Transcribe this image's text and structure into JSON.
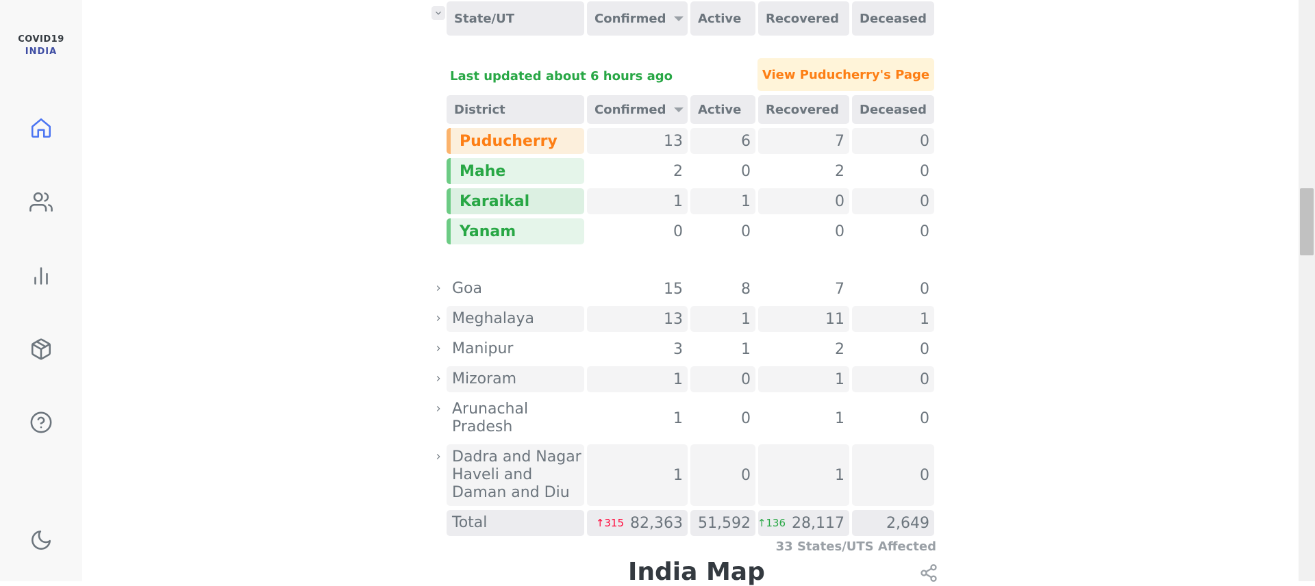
{
  "sidebar": {
    "logo_line1": "COVID19",
    "logo_line2": "INDIA",
    "items": [
      {
        "icon": "home-icon",
        "active": true
      },
      {
        "icon": "users-icon"
      },
      {
        "icon": "bar-chart-icon"
      },
      {
        "icon": "package-icon"
      },
      {
        "icon": "help-circle-icon"
      },
      {
        "icon": "moon-icon"
      }
    ]
  },
  "table": {
    "headers": {
      "state": "State/UT",
      "confirmed": "Confirmed",
      "active": "Active",
      "recovered": "Recovered",
      "deceased": "Deceased"
    },
    "expanded_state": {
      "last_updated": "Last updated about 6 hours ago",
      "view_page_button": "View Puducherry's Page",
      "district_headers": {
        "district": "District",
        "confirmed": "Confirmed",
        "active": "Active",
        "recovered": "Recovered",
        "deceased": "Deceased"
      },
      "districts": [
        {
          "name": "Puducherry",
          "confirmed": "13",
          "active": "6",
          "recovered": "7",
          "deceased": "0"
        },
        {
          "name": "Mahe",
          "confirmed": "2",
          "active": "0",
          "recovered": "2",
          "deceased": "0"
        },
        {
          "name": "Karaikal",
          "confirmed": "1",
          "active": "1",
          "recovered": "0",
          "deceased": "0"
        },
        {
          "name": "Yanam",
          "confirmed": "0",
          "active": "0",
          "recovered": "0",
          "deceased": "0"
        }
      ]
    },
    "rows": [
      {
        "name": "Goa",
        "confirmed": "15",
        "active": "8",
        "recovered": "7",
        "deceased": "0"
      },
      {
        "name": "Meghalaya",
        "confirmed": "13",
        "active": "1",
        "recovered": "11",
        "deceased": "1"
      },
      {
        "name": "Manipur",
        "confirmed": "3",
        "active": "1",
        "recovered": "2",
        "deceased": "0"
      },
      {
        "name": "Mizoram",
        "confirmed": "1",
        "active": "0",
        "recovered": "1",
        "deceased": "0"
      },
      {
        "name": "Arunachal\nPradesh",
        "confirmed": "1",
        "active": "0",
        "recovered": "1",
        "deceased": "0"
      },
      {
        "name": "Dadra and Nagar\nHaveli and\nDaman and Diu",
        "confirmed": "1",
        "active": "0",
        "recovered": "1",
        "deceased": "0"
      }
    ],
    "total": {
      "label": "Total",
      "confirmed_delta": "↑315",
      "confirmed": "82,363",
      "active": "51,592",
      "recovered_delta": "↑136",
      "recovered": "28,117",
      "deceased": "2,649"
    },
    "affected_text": "33 States/UTS Affected"
  },
  "map": {
    "title": "India Map"
  },
  "colors": {
    "orange": "#fd7e14",
    "green": "#28a745",
    "red": "#ff073a",
    "blue": "#3e4da3"
  }
}
